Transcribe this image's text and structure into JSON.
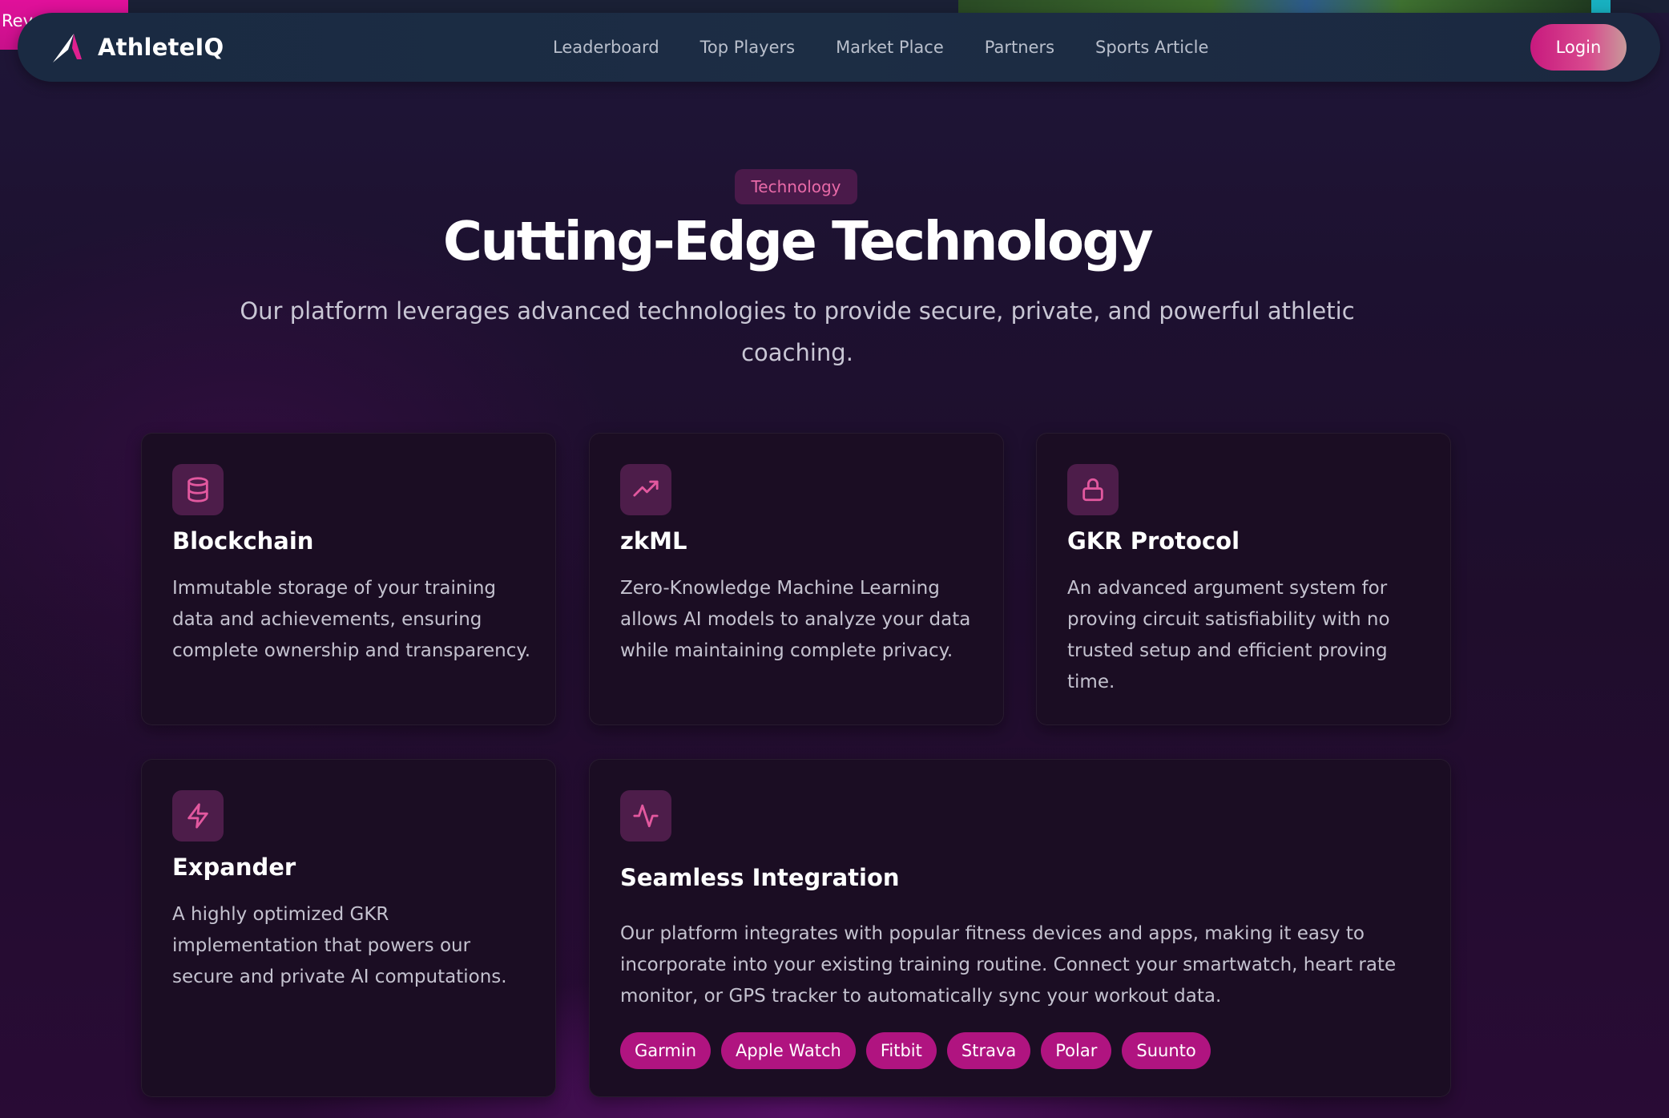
{
  "top_strip": {
    "partial_text": "Rev"
  },
  "nav": {
    "brand": "AthleteIQ",
    "links": [
      "Leaderboard",
      "Top Players",
      "Market Place",
      "Partners",
      "Sports Article"
    ],
    "login": "Login"
  },
  "hero": {
    "badge": "Technology",
    "title": "Cutting-Edge Technology",
    "subtitle": "Our platform leverages advanced technologies to provide secure, private, and powerful athletic coaching."
  },
  "cards": [
    {
      "icon": "database-icon",
      "title": "Blockchain",
      "description": "Immutable storage of your training data and achievements, ensuring complete ownership and transparency."
    },
    {
      "icon": "trending-up-icon",
      "title": "zkML",
      "description": "Zero-Knowledge Machine Learning allows AI models to analyze your data while maintaining complete privacy."
    },
    {
      "icon": "lock-icon",
      "title": "GKR Protocol",
      "description": "An advanced argument system for proving circuit satisfiability with no trusted setup and efficient proving time."
    },
    {
      "icon": "lightning-icon",
      "title": "Expander",
      "description": "A highly optimized GKR implementation that powers our secure and private AI computations."
    },
    {
      "icon": "activity-icon",
      "title": "Seamless Integration",
      "description": "Our platform integrates with popular fitness devices and apps, making it easy to incorporate into your existing training routine. Connect your smartwatch, heart rate monitor, or GPS tracker to automatically sync your workout data.",
      "tags": [
        "Garmin",
        "Apple Watch",
        "Fitbit",
        "Strava",
        "Polar",
        "Suunto"
      ]
    }
  ],
  "colors": {
    "accent": "#c8197e",
    "tag": "#b01480",
    "icon_tile": "#4d1d4a",
    "icon_stroke": "#e2589f"
  }
}
